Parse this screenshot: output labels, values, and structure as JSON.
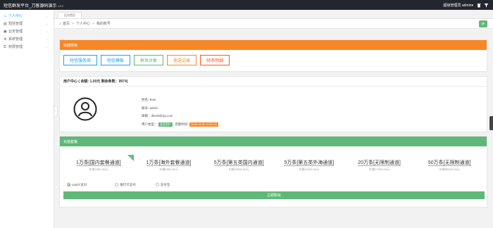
{
  "topbar": {
    "title": "短信群发平台_刀客源码演示",
    "version": "v3.0",
    "user_label": "超级管理员 admin",
    "user_caret": "▾"
  },
  "sidebar": {
    "items": [
      {
        "label": "个人中心",
        "icon": "user-icon",
        "active": true
      },
      {
        "label": "短信管理",
        "icon": "message-icon"
      },
      {
        "label": "业务管理",
        "icon": "business-icon"
      },
      {
        "label": "系统管理",
        "icon": "gear-icon"
      },
      {
        "label": "权限管理",
        "icon": "lock-icon"
      }
    ],
    "toggle_glyph": "‹"
  },
  "tabs": [
    {
      "label": "后台首页"
    }
  ],
  "breadcrumb": {
    "home": "首页",
    "level1": "个人中心",
    "level2": "我的账号",
    "sep": ">"
  },
  "quick": {
    "title": "快捷链接",
    "buttons": [
      "短信服务商",
      "短信模板",
      "群发对象",
      "发送记录",
      "财务明细"
    ]
  },
  "user_center": {
    "title": "用户中心 ( 余额: 1.00元  剩余条数：9974)",
    "name_label": "姓名:",
    "name_value": "Bow",
    "account_label": "账号:",
    "account_value": "admin",
    "email_label": "邮箱：",
    "email_value": "dkewl@qq.com",
    "type_label": "用户类型：",
    "type_badge": "会员用户",
    "expiry_label": "到期时间:",
    "expiry_badge": "2026-06-30 21:09:24"
  },
  "packages": {
    "title": "充值套餐",
    "items": [
      {
        "name": "1万条[国内套餐通道]",
        "price": "价格2350.00元"
      },
      {
        "name": "1万条[海外套餐通道]",
        "price": "价格2550.00元"
      },
      {
        "name": "5万条[第五类国内通道]",
        "price": "价格10000.00元"
      },
      {
        "name": "5万条[第五类外海通道]",
        "price": "价格11000.00元"
      },
      {
        "name": "20万条[无限制通道]",
        "price": "价格27000.00元"
      },
      {
        "name": "50万条[无限制通道]",
        "price": "价格55000.00元"
      }
    ],
    "payments": [
      {
        "label": "USDT支付",
        "selected": true
      },
      {
        "label": "银行卡支付",
        "selected": false
      },
      {
        "label": "支付宝",
        "selected": false
      }
    ],
    "buy_label": "立即购买"
  },
  "colors": {
    "accent_green": "#5fb878",
    "accent_orange": "#f78725",
    "accent_blue": "#1e9fff",
    "topbar_bg": "#23262e"
  }
}
